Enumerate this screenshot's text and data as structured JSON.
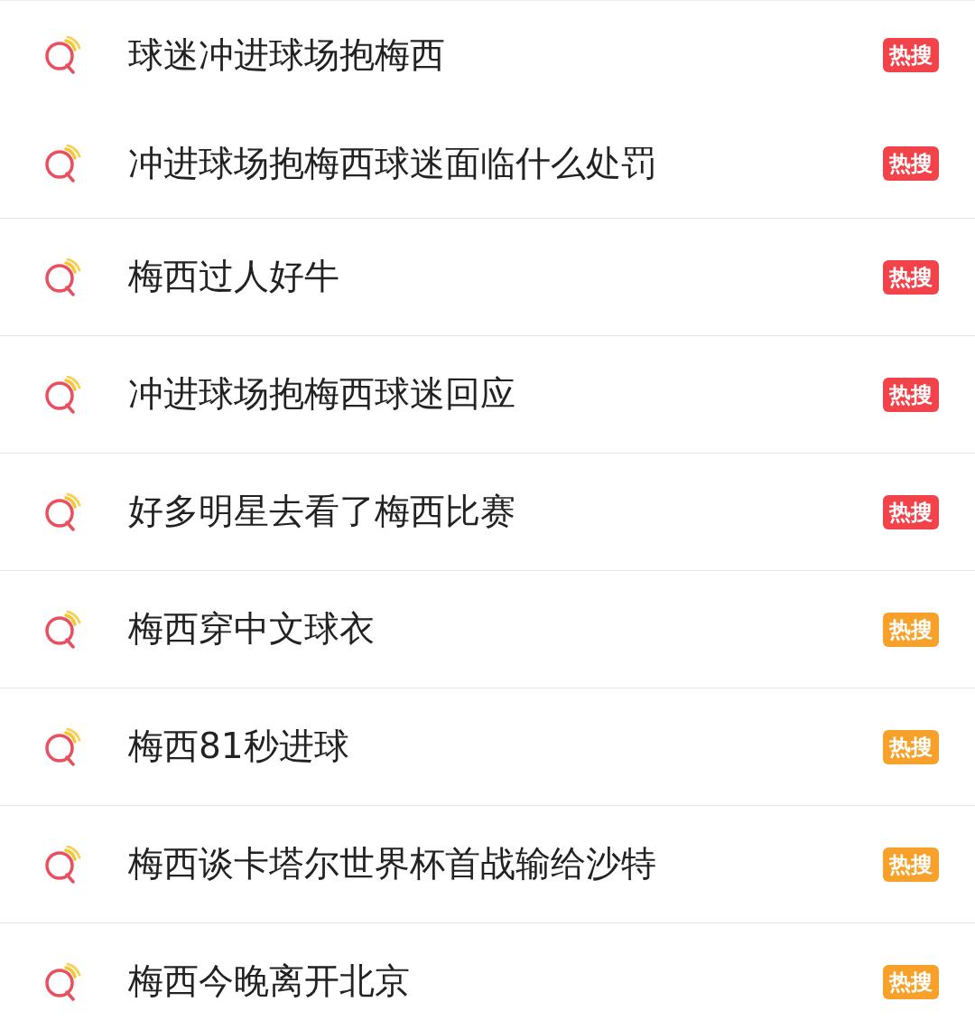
{
  "results": [
    {
      "text": "球迷冲进球场抱梅西",
      "badge": {
        "label": "热搜",
        "color": "#f3434a"
      }
    },
    {
      "text": "冲进球场抱梅西球迷面临什么处罚",
      "badge": {
        "label": "热搜",
        "color": "#f3434a"
      }
    },
    {
      "text": "梅西过人好牛",
      "badge": {
        "label": "热搜",
        "color": "#f3434a"
      }
    },
    {
      "text": "冲进球场抱梅西球迷回应",
      "badge": {
        "label": "热搜",
        "color": "#f3434a"
      }
    },
    {
      "text": "好多明星去看了梅西比赛",
      "badge": {
        "label": "热搜",
        "color": "#f3434a"
      }
    },
    {
      "text": "梅西穿中文球衣",
      "badge": {
        "label": "热搜",
        "color": "#f7a12b"
      }
    },
    {
      "text": "梅西81秒进球",
      "badge": {
        "label": "热搜",
        "color": "#f7a12b"
      }
    },
    {
      "text": "梅西谈卡塔尔世界杯首战输给沙特",
      "badge": {
        "label": "热搜",
        "color": "#f7a12b"
      }
    },
    {
      "text": "梅西今晚离开北京",
      "badge": {
        "label": "热搜",
        "color": "#f7a12b"
      }
    }
  ]
}
